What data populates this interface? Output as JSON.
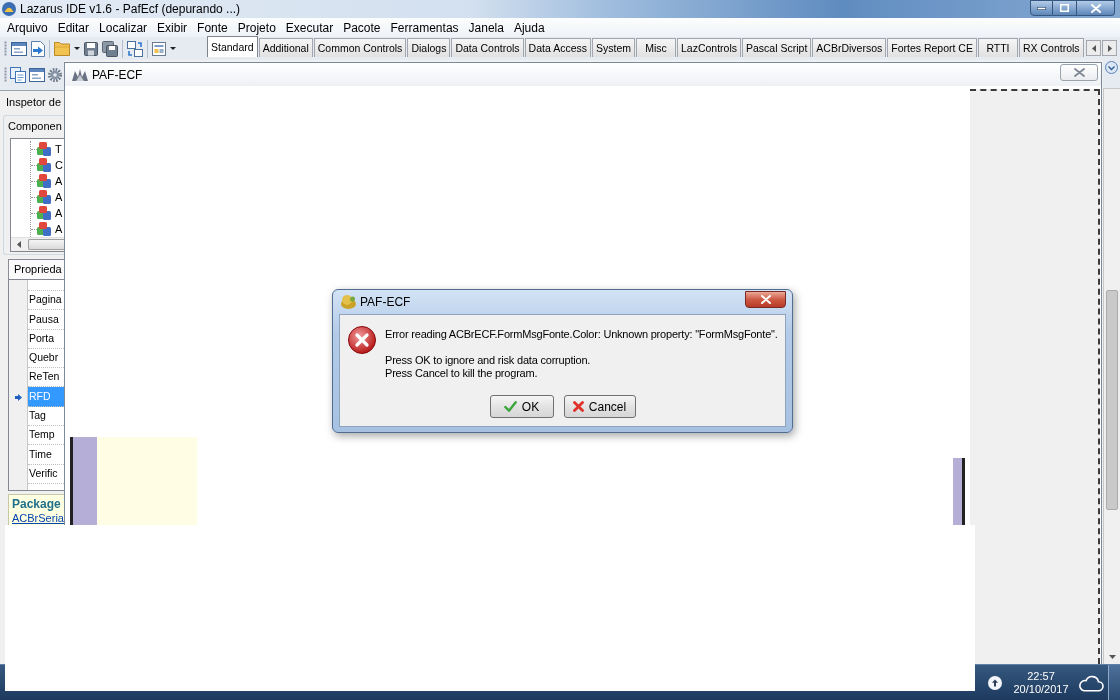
{
  "window": {
    "title": "Lazarus IDE v1.6 - PafEcf (depurando ...)"
  },
  "menu": [
    "Arquivo",
    "Editar",
    "Localizar",
    "Exibir",
    "Fonte",
    "Projeto",
    "Executar",
    "Pacote",
    "Ferramentas",
    "Janela",
    "Ajuda"
  ],
  "palette_tabs": [
    {
      "label": "Standard",
      "selected": true
    },
    {
      "label": "Additional",
      "selected": false
    },
    {
      "label": "Common Controls",
      "selected": false
    },
    {
      "label": "Dialogs",
      "selected": false
    },
    {
      "label": "Data Controls",
      "selected": false
    },
    {
      "label": "Data Access",
      "selected": false
    },
    {
      "label": "System",
      "selected": false
    },
    {
      "label": "Misc",
      "selected": false
    },
    {
      "label": "LazControls",
      "selected": false
    },
    {
      "label": "Pascal Script",
      "selected": false
    },
    {
      "label": "ACBrDiversos",
      "selected": false
    },
    {
      "label": "Fortes Report CE",
      "selected": false
    },
    {
      "label": "RTTI",
      "selected": false
    },
    {
      "label": "RX Controls",
      "selected": false
    }
  ],
  "object_inspector": {
    "title": "Inspetor de",
    "components_label": "Componen",
    "tree_items": [
      "T",
      "C",
      "A",
      "A",
      "A",
      "A"
    ],
    "properties_tab": "Proprieda",
    "properties": [
      {
        "name": "Pagina",
        "selected": false
      },
      {
        "name": "Pausa",
        "selected": false
      },
      {
        "name": "Porta",
        "selected": false
      },
      {
        "name": "Quebr",
        "selected": false
      },
      {
        "name": "ReTen",
        "selected": false
      },
      {
        "name": "RFD",
        "selected": true
      },
      {
        "name": "Tag",
        "selected": false
      },
      {
        "name": "Temp",
        "selected": false
      },
      {
        "name": "Time",
        "selected": false
      },
      {
        "name": "Verific",
        "selected": false
      }
    ],
    "package_label": "Package",
    "package_link": "ACBrSeria"
  },
  "form_window": {
    "title": "PAF-ECF"
  },
  "dialog": {
    "title": "PAF-ECF",
    "message": "Error reading ACBrECF.FormMsgFonte.Color: Unknown property: \"FormMsgFonte\".",
    "lines": [
      "Press OK to ignore and risk data corruption.",
      "Press Cancel to kill the program."
    ],
    "buttons": [
      {
        "label": "OK",
        "kind": "ok"
      },
      {
        "label": "Cancel",
        "kind": "cancel"
      }
    ]
  },
  "taskbar": {
    "time": "22:57",
    "date": "20/10/2017"
  }
}
